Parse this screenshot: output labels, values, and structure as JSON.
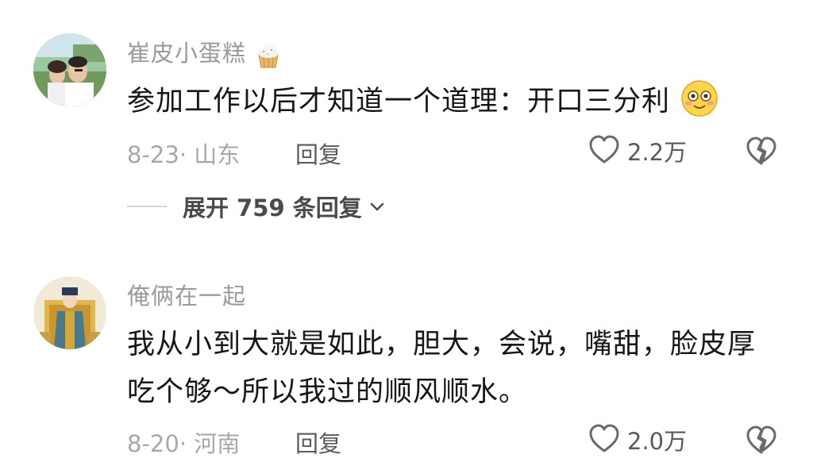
{
  "comments": [
    {
      "username": "崔皮小蛋糕",
      "username_emoji": "cupcake-icon",
      "text": "参加工作以后才知道一个道理：开口三分利",
      "text_emoji": "smiling-face-icon",
      "date_location": "8-23· 山东",
      "reply_label": "回复",
      "likes": "2.2万",
      "expand_label": "展开 759 条回复"
    },
    {
      "username": "俺俩在一起",
      "text": "我从小到大就是如此，胆大，会说，嘴甜，脸皮厚吃个够～所以我过的顺风顺水。",
      "date_location": "8-20· 河南",
      "reply_label": "回复",
      "likes": "2.0万"
    }
  ],
  "colors": {
    "username": "#9a9a9a",
    "body": "#161616",
    "meta": "#a8a8a8",
    "action": "#5a5a5a"
  }
}
